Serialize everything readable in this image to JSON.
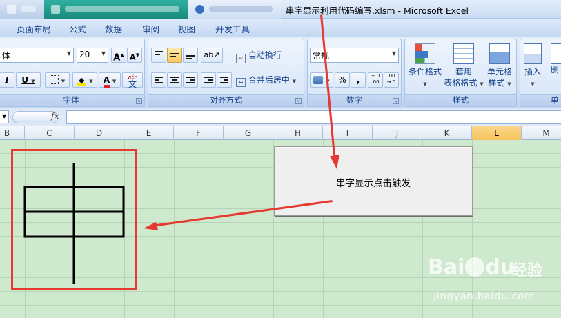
{
  "window": {
    "title": "串字显示利用代码编写.xlsm  -  Microsoft Excel"
  },
  "ribbon_tabs": [
    "页面布局",
    "公式",
    "数据",
    "审阅",
    "视图",
    "开发工具"
  ],
  "font_group": {
    "font_name": "体",
    "font_size": "20",
    "grow_label": "A",
    "shrink_label": "A",
    "italic": "I",
    "underline": "U",
    "font_color_letter": "A",
    "phonetic_top": "wén",
    "phonetic_char": "文",
    "label": "字体"
  },
  "alignment_group": {
    "wrap_text": "自动换行",
    "merge_center": "合并后居中",
    "label": "对齐方式"
  },
  "number_group": {
    "format": "常规",
    "percent": "%",
    "comma": ",",
    "inc_decimal": "+.0 .00",
    "dec_decimal": ".00 →.0",
    "label": "数字"
  },
  "styles_group": {
    "conditional_format": "条件格式",
    "table_format_line1": "套用",
    "table_format_line2": "表格格式",
    "cell_style_line1": "单元格",
    "cell_style_line2": "样式",
    "label": "样式"
  },
  "cells_group": {
    "insert": "插入",
    "delete_partial": "删",
    "label_partial": "单"
  },
  "formula_bar": {
    "fx": "fx",
    "content": ""
  },
  "columns": [
    "B",
    "C",
    "D",
    "E",
    "F",
    "G",
    "H",
    "I",
    "J",
    "K",
    "L",
    "M"
  ],
  "selected_column": "L",
  "macro_button": {
    "label": "串字显示点击触发"
  },
  "watermark": {
    "logo": "Bai du",
    "cn": "经验",
    "url": "jingyan.baidu.com"
  },
  "colors": {
    "sheet_background": "#cfe9cf",
    "annotation_red": "#e53a32",
    "ribbon_text": "#15428b",
    "selected_column": "#f7c25a"
  }
}
